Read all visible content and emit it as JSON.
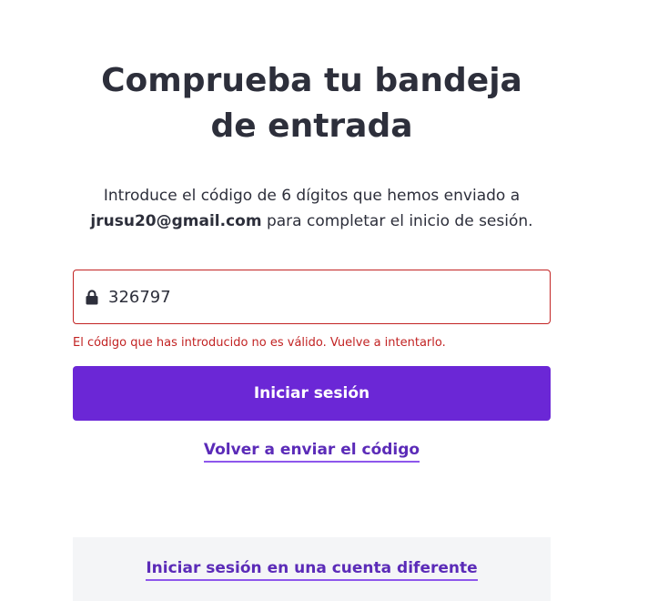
{
  "title": "Comprueba tu bandeja de entrada",
  "instructions": {
    "before_email": "Introduce el código de 6 dígitos que hemos enviado a",
    "email": "jrusu20@gmail.com",
    "after_email": "para completar el inicio de sesión."
  },
  "code_field": {
    "value": "326797",
    "icon": "lock-icon"
  },
  "error": "El código que has introducido no es válido. Vuelve a intentarlo.",
  "submit_label": "Iniciar sesión",
  "resend_label": "Volver a enviar el código",
  "alt_account_label": "Iniciar sesión en una cuenta diferente",
  "colors": {
    "primary": "#6b27d6",
    "error": "#c22323",
    "link": "#5b2bb8",
    "text": "#2d2f3b",
    "panel": "#f4f5f7"
  }
}
